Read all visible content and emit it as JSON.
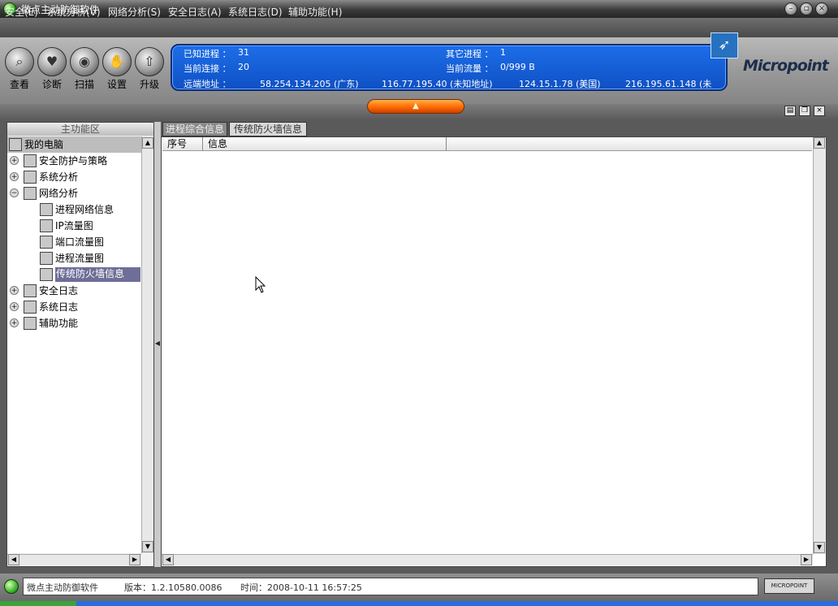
{
  "window": {
    "title": "微点主动防御软件"
  },
  "menu": [
    "安全(E)",
    "系统分析(V)",
    "网络分析(S)",
    "安全日志(A)",
    "系统日志(D)",
    "辅助功能(H)"
  ],
  "toolbar": {
    "buttons": [
      {
        "label": "查看",
        "icon": "magnifier-icon"
      },
      {
        "label": "诊断",
        "icon": "heart-icon"
      },
      {
        "label": "扫描",
        "icon": "scan-icon"
      },
      {
        "label": "设置",
        "icon": "hand-settings-icon"
      },
      {
        "label": "升级",
        "icon": "upgrade-icon"
      }
    ]
  },
  "info": {
    "known_process_label": "已知进程 ：",
    "known_process_value": "31",
    "other_process_label": "其它进程 ：",
    "other_process_value": "1",
    "connections_label": "当前连接 ：",
    "connections_value": "20",
    "traffic_label": "当前流量 ：",
    "traffic_value": "0/999 B",
    "remote_label": "远端地址 ：",
    "remote_addresses": [
      "58.254.134.205 (广东)",
      "116.77.195.40 (未知地址)",
      "124.15.1.78 (美国)",
      "216.195.61.148 (未"
    ]
  },
  "brand": {
    "logo": "Micropoint",
    "status_logo": "MICROPOINT"
  },
  "sidebar": {
    "header": "主功能区",
    "tree": [
      {
        "label": "我的电脑",
        "level": 0,
        "expander": "",
        "icon": "computer-icon",
        "selected": false,
        "root": true
      },
      {
        "label": "安全防护与策略",
        "level": 1,
        "expander": "+",
        "icon": "shield-policy-icon"
      },
      {
        "label": "系统分析",
        "level": 1,
        "expander": "+",
        "icon": "system-icon"
      },
      {
        "label": "网络分析",
        "level": 1,
        "expander": "−",
        "icon": "network-icon"
      },
      {
        "label": "进程网络信息",
        "level": 2,
        "expander": "",
        "icon": "process-network-icon"
      },
      {
        "label": "IP流量图",
        "level": 2,
        "expander": "",
        "icon": "ip-traffic-icon"
      },
      {
        "label": "端口流量图",
        "level": 2,
        "expander": "",
        "icon": "port-traffic-icon"
      },
      {
        "label": "进程流量图",
        "level": 2,
        "expander": "",
        "icon": "process-traffic-icon"
      },
      {
        "label": "传统防火墙信息",
        "level": 2,
        "expander": "",
        "icon": "firewall-icon",
        "selected": true
      },
      {
        "label": "安全日志",
        "level": 1,
        "expander": "+",
        "icon": "security-log-icon"
      },
      {
        "label": "系统日志",
        "level": 1,
        "expander": "+",
        "icon": "system-log-icon"
      },
      {
        "label": "辅助功能",
        "level": 1,
        "expander": "+",
        "icon": "tools-icon"
      }
    ]
  },
  "tabs": [
    {
      "label": "进程综合信息",
      "active": false
    },
    {
      "label": "传统防火墙信息",
      "active": true
    }
  ],
  "table": {
    "columns": [
      "序号",
      "信息"
    ],
    "rows": []
  },
  "status": {
    "app": "微点主动防御软件",
    "version": "版本：1.2.10580.0086",
    "time": "时间：2008-10-11 16:57:25"
  }
}
